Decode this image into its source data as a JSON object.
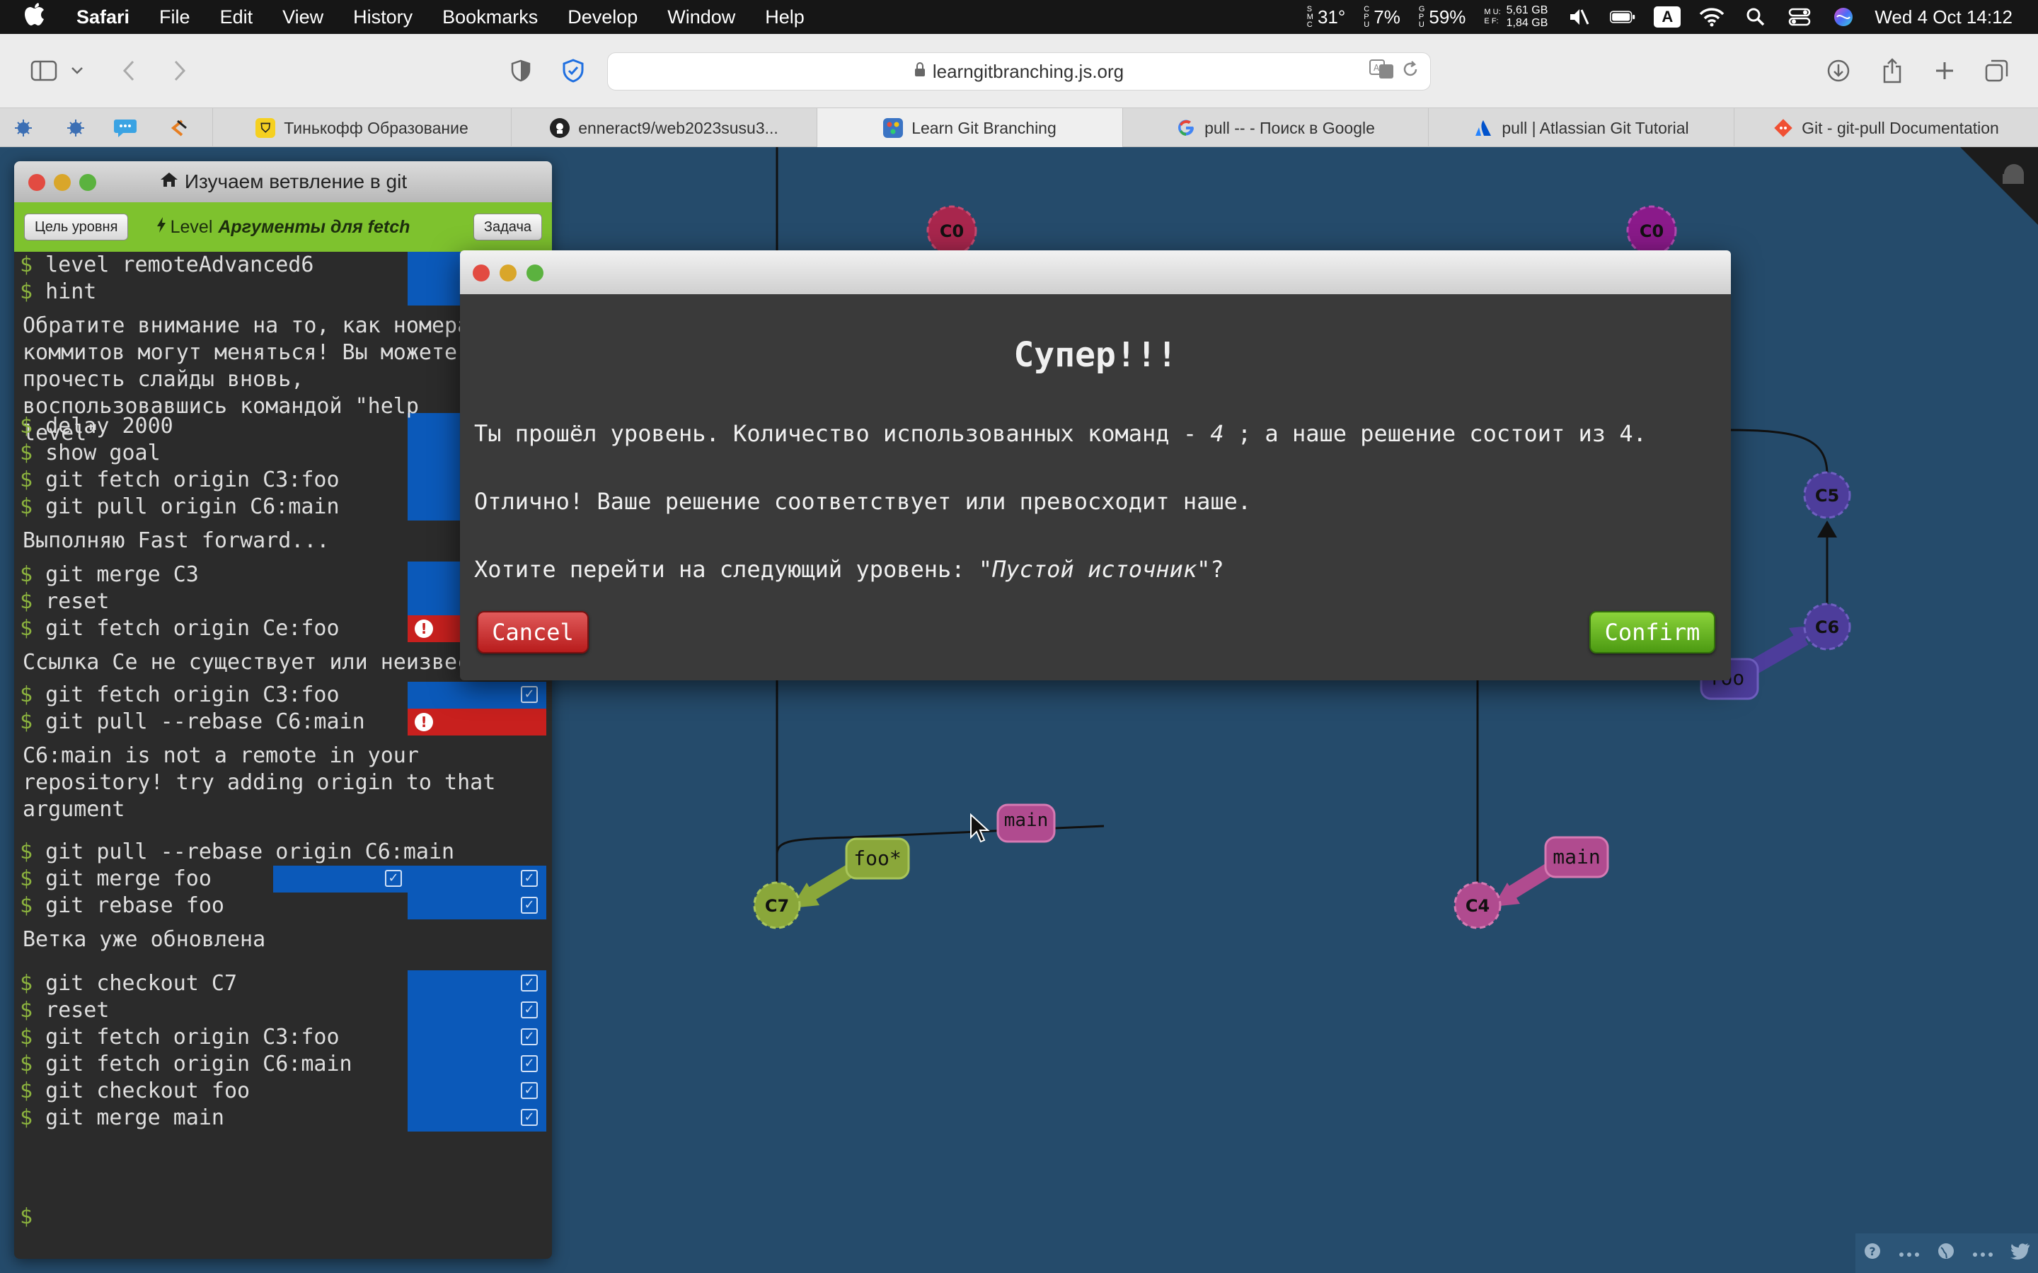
{
  "menubar": {
    "app_name": "Safari",
    "menus": [
      "File",
      "Edit",
      "View",
      "History",
      "Bookmarks",
      "Develop",
      "Window",
      "Help"
    ],
    "temp": "31°",
    "cpu": "7%",
    "gpu": "59%",
    "mem_line1": "5,61 GB",
    "mem_line2": "1,84 GB",
    "input_source": "A",
    "datetime": "Wed 4 Oct  14:12"
  },
  "browser": {
    "url": "learngitbranching.js.org"
  },
  "tabs": [
    {
      "label": "Тинькофф Образование"
    },
    {
      "label": "enneract9/web2023susu3..."
    },
    {
      "label": "Learn Git Branching"
    },
    {
      "label": "pull -- - Поиск в Google"
    },
    {
      "label": "pull | Atlassian Git Tutorial"
    },
    {
      "label": "Git - git-pull Documentation"
    }
  ],
  "terminal": {
    "title": "Изучаем ветвление в git",
    "goal_button": "Цель уровня",
    "level_prefix": "Level",
    "level_name": "Аргументы для fetch",
    "task_button": "Задача",
    "lines": [
      {
        "type": "cmd",
        "text": "level remoteAdvanced6"
      },
      {
        "type": "cmd",
        "text": "hint"
      },
      {
        "type": "msg",
        "text": "Обратите внимание на то, как номера\nкоммитов могут меняться! Вы можете\nпрочесть слайды вновь,\nвоспользовавшись командой \"help level\""
      },
      {
        "type": "cmd",
        "text": "delay 2000"
      },
      {
        "type": "cmd",
        "text": "show goal"
      },
      {
        "type": "cmd",
        "text": "git fetch origin C3:foo"
      },
      {
        "type": "cmd",
        "text": "git pull origin C6:main"
      },
      {
        "type": "msg",
        "text": "Выполняю Fast forward..."
      },
      {
        "type": "cmd",
        "text": "git merge C3"
      },
      {
        "type": "cmd",
        "text": "reset"
      },
      {
        "type": "cmd",
        "text": "git fetch origin Ce:foo"
      },
      {
        "type": "msg",
        "text": "Ссылка Ce не существует или неизвестна"
      },
      {
        "type": "cmd",
        "text": "git fetch origin C3:foo"
      },
      {
        "type": "cmd",
        "text": "git pull --rebase C6:main"
      },
      {
        "type": "msg",
        "text": "C6:main is not a remote in your\nrepository! try adding origin to that\nargument"
      },
      {
        "type": "cmd",
        "text": "git pull --rebase origin C6:main"
      },
      {
        "type": "cmd",
        "text": "git merge foo"
      },
      {
        "type": "cmd",
        "text": "git rebase foo"
      },
      {
        "type": "msg",
        "text": "Ветка уже обновлена"
      },
      {
        "type": "cmd",
        "text": "git checkout C7"
      },
      {
        "type": "cmd",
        "text": "reset"
      },
      {
        "type": "cmd",
        "text": "git fetch origin C3:foo"
      },
      {
        "type": "cmd",
        "text": "git fetch origin C6:main"
      },
      {
        "type": "cmd",
        "text": "git checkout foo"
      },
      {
        "type": "cmd",
        "text": "git merge main"
      }
    ],
    "prompt": "$"
  },
  "graph": {
    "left_nodes": {
      "c0": "C0",
      "c7": "C7"
    },
    "left_branches": {
      "main": "main",
      "foo": "foo*"
    },
    "right_nodes": {
      "c0": "C0",
      "c5": "C5",
      "c6": "C6",
      "c4": "C4"
    },
    "right_branches": {
      "foo": "foo",
      "main": "main"
    },
    "colors": {
      "background": "#254b6b",
      "main": "#b04b8f",
      "foo": "#8aa73a",
      "remote": "#4d3d9b",
      "c0": "#a8264d"
    }
  },
  "modal": {
    "heading": "Супер!!!",
    "line1_prefix": "Ты прошёл уровень. Количество использованных команд - ",
    "line1_count": "4",
    "line1_suffix": " ; а наше решение состоит из 4.",
    "line2": "Отлично! Ваше решение соответствует или превосходит наше.",
    "line3_prefix": "Хотите перейти на следующий уровень: \"",
    "line3_level": "Пустой источник",
    "line3_suffix": "\"?",
    "cancel_label": "Cancel",
    "confirm_label": "Confirm"
  }
}
